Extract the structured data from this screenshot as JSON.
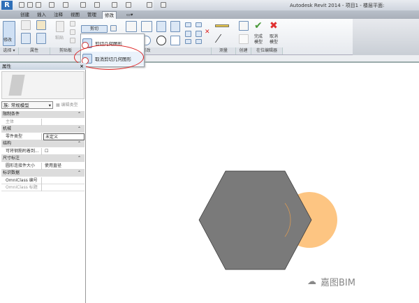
{
  "titlebar": {
    "app_title": "Autodesk Revit 2014 -    项目1 - 楼层平面:"
  },
  "tabs": [
    {
      "label": "创建"
    },
    {
      "label": "插入"
    },
    {
      "label": "注释"
    },
    {
      "label": "视图"
    },
    {
      "label": "管理"
    },
    {
      "label": "修改",
      "active": true
    },
    {
      "label": "▭▾"
    }
  ],
  "ribbon": {
    "modify_label": "修改",
    "paste_label": "粘贴",
    "cut_split_label": "剪切",
    "finish_label": "完成\n模型",
    "cancel_label": "取消\n模型",
    "panels": [
      "选择 ▾",
      "属性",
      "剪贴板",
      "修改",
      "测量",
      "创建",
      "在位编辑器"
    ]
  },
  "cut_menu": {
    "items": [
      "剪切几何图形",
      "取消剪切几何图形"
    ],
    "highlighted": 1
  },
  "properties": {
    "title": "属性",
    "close": "×",
    "type_selector": "族: 常规模型",
    "edit_type": "编辑类型",
    "rows": [
      {
        "cat": "限制条件"
      },
      {
        "k": "主体",
        "v": "",
        "gray": true
      },
      {
        "cat": "机械"
      },
      {
        "k": "零件类型",
        "v": "未定义"
      },
      {
        "cat": "结构"
      },
      {
        "k": "可将钢筋附着到...",
        "v": "☐"
      },
      {
        "cat": "尺寸标注"
      },
      {
        "k": "圆形连接件大小",
        "v": "使用直径"
      },
      {
        "cat": "标识数据"
      },
      {
        "k": "OmniClass 编号",
        "v": ""
      },
      {
        "k": "OmniClass 标题",
        "v": "",
        "gray": true
      }
    ]
  },
  "canvas": {
    "hexagon_color": "#7a7a7a",
    "circle_color": "#fdc582",
    "circle_outline": "#d99a55"
  },
  "watermark": "嘉图BIM"
}
